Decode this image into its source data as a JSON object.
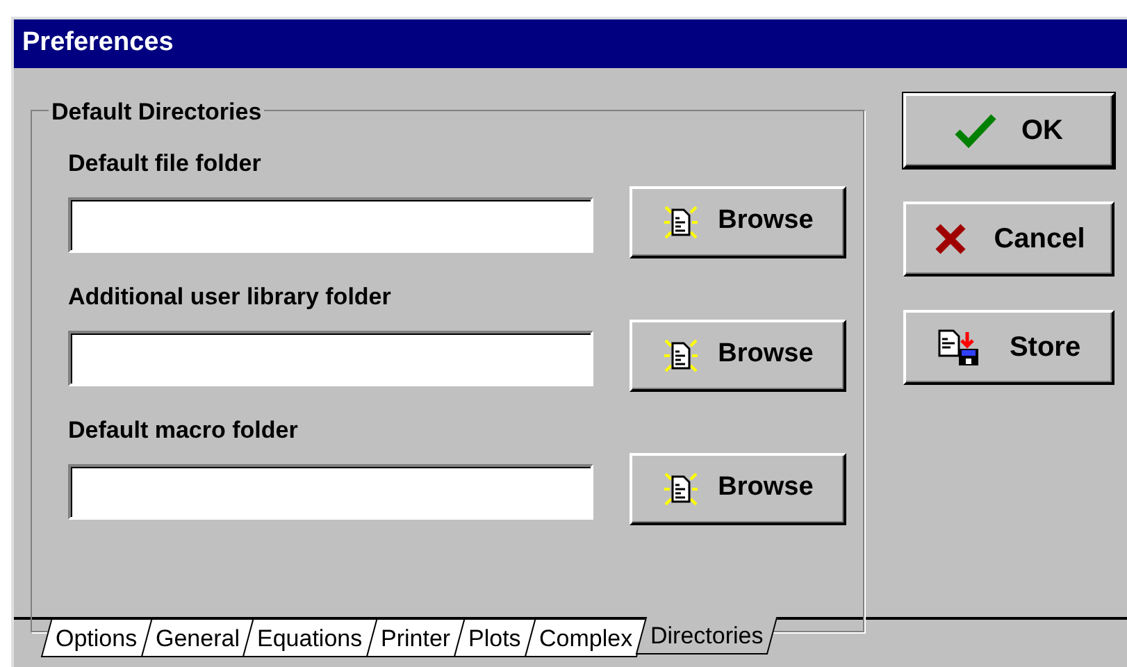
{
  "window": {
    "title": "Preferences"
  },
  "group": {
    "title": "Default Directories",
    "fields": [
      {
        "label": "Default file folder",
        "button": "Browse"
      },
      {
        "label": "Additional user library folder",
        "button": "Browse"
      },
      {
        "label": "Default macro folder",
        "button": "Browse"
      }
    ]
  },
  "actions": [
    {
      "kind": "ok",
      "label": "OK"
    },
    {
      "kind": "cancel",
      "label": "Cancel"
    },
    {
      "kind": "store",
      "label": "Store"
    }
  ],
  "tabs": [
    {
      "label": "Options",
      "selected": false
    },
    {
      "label": "General",
      "selected": false
    },
    {
      "label": "Equations",
      "selected": false
    },
    {
      "label": "Printer",
      "selected": false
    },
    {
      "label": "Plots",
      "selected": false
    },
    {
      "label": "Complex",
      "selected": false
    },
    {
      "label": "Directories",
      "selected": true
    }
  ]
}
